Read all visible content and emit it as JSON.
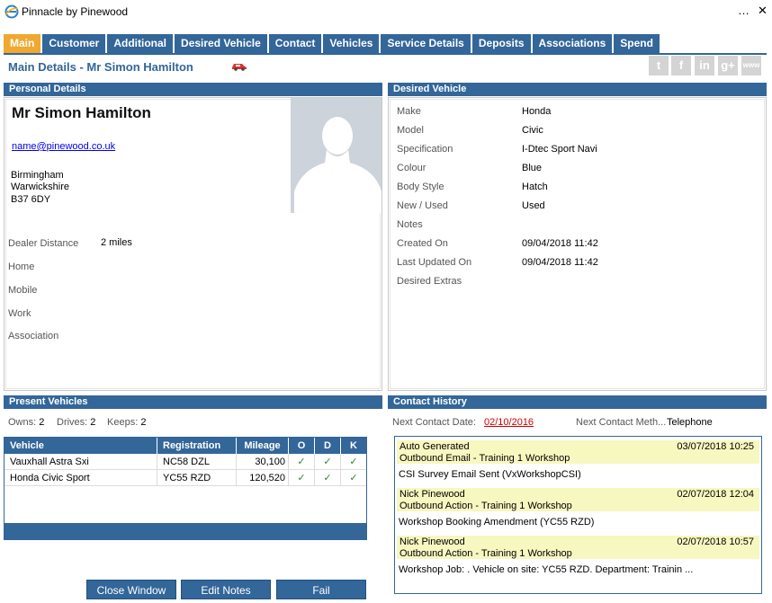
{
  "window": {
    "title": "Pinnacle by Pinewood",
    "minimize": "…",
    "close": "✕"
  },
  "tabs": [
    "Main",
    "Customer",
    "Additional",
    "Desired Vehicle",
    "Contact",
    "Vehicles",
    "Service Details",
    "Deposits",
    "Associations",
    "Spend"
  ],
  "heading": "Main Details - Mr Simon Hamilton",
  "social": [
    "t",
    "f",
    "in",
    "g+",
    "www"
  ],
  "personal": {
    "header": "Personal Details",
    "name": "Mr Simon Hamilton",
    "email": "name@pinewood.co.uk",
    "address": [
      "Birmingham",
      "Warwickshire",
      "B37 6DY"
    ],
    "fields": [
      {
        "label": "Dealer Distance",
        "value": "2 miles"
      },
      {
        "label": "Home",
        "value": ""
      },
      {
        "label": "Mobile",
        "value": ""
      },
      {
        "label": "Work",
        "value": ""
      },
      {
        "label": "Association",
        "value": ""
      }
    ]
  },
  "desired": {
    "header": "Desired Vehicle",
    "fields": [
      {
        "label": "Make",
        "value": "Honda"
      },
      {
        "label": "Model",
        "value": "Civic"
      },
      {
        "label": "Specification",
        "value": "I-Dtec Sport Navi"
      },
      {
        "label": "Colour",
        "value": "Blue"
      },
      {
        "label": "Body Style",
        "value": "Hatch"
      },
      {
        "label": "New / Used",
        "value": "Used"
      },
      {
        "label": "Notes",
        "value": ""
      },
      {
        "label": "Created On",
        "value": "09/04/2018 11:42"
      },
      {
        "label": "Last Updated On",
        "value": "09/04/2018 11:42"
      },
      {
        "label": "Desired Extras",
        "value": ""
      }
    ]
  },
  "present": {
    "header": "Present Vehicles",
    "owns_label": "Owns:",
    "owns": "2",
    "drives_label": "Drives:",
    "drives": "2",
    "keeps_label": "Keeps:",
    "keeps": "2",
    "columns": [
      "Vehicle",
      "Registration",
      "Mileage",
      "O",
      "D",
      "K"
    ],
    "rows": [
      {
        "vehicle": "Vauxhall Astra Sxi",
        "reg": "NC58 DZL",
        "mileage": "30,100",
        "o": "✓",
        "d": "✓",
        "k": "✓"
      },
      {
        "vehicle": "Honda Civic Sport",
        "reg": "YC55 RZD",
        "mileage": "120,520",
        "o": "✓",
        "d": "✓",
        "k": "✓"
      }
    ]
  },
  "contact": {
    "header": "Contact History",
    "next_date_label": "Next Contact Date:",
    "next_date": "02/10/2016",
    "next_method_label": "Next Contact Meth...",
    "next_method": "Telephone",
    "items": [
      {
        "who": "Auto Generated",
        "when": "03/07/2018 10:25",
        "action": "Outbound Email - Training 1 Workshop",
        "body": "CSI Survey Email Sent (VxWorkshopCSI)"
      },
      {
        "who": "Nick Pinewood",
        "when": "02/07/2018 12:04",
        "action": "Outbound Action - Training 1 Workshop",
        "body": "Workshop Booking Amendment (YC55 RZD)"
      },
      {
        "who": "Nick Pinewood",
        "when": "02/07/2018 10:57",
        "action": "Outbound Action - Training 1 Workshop",
        "body": "Workshop Job: . Vehicle on site: YC55 RZD. Department: Trainin ..."
      }
    ]
  },
  "buttons": {
    "close": "Close Window",
    "edit": "Edit Notes",
    "fail": "Fail"
  },
  "colors": {
    "tab_blue": "#336699",
    "tab_active": "#f0a830",
    "history_highlight": "#f7f7c0"
  }
}
